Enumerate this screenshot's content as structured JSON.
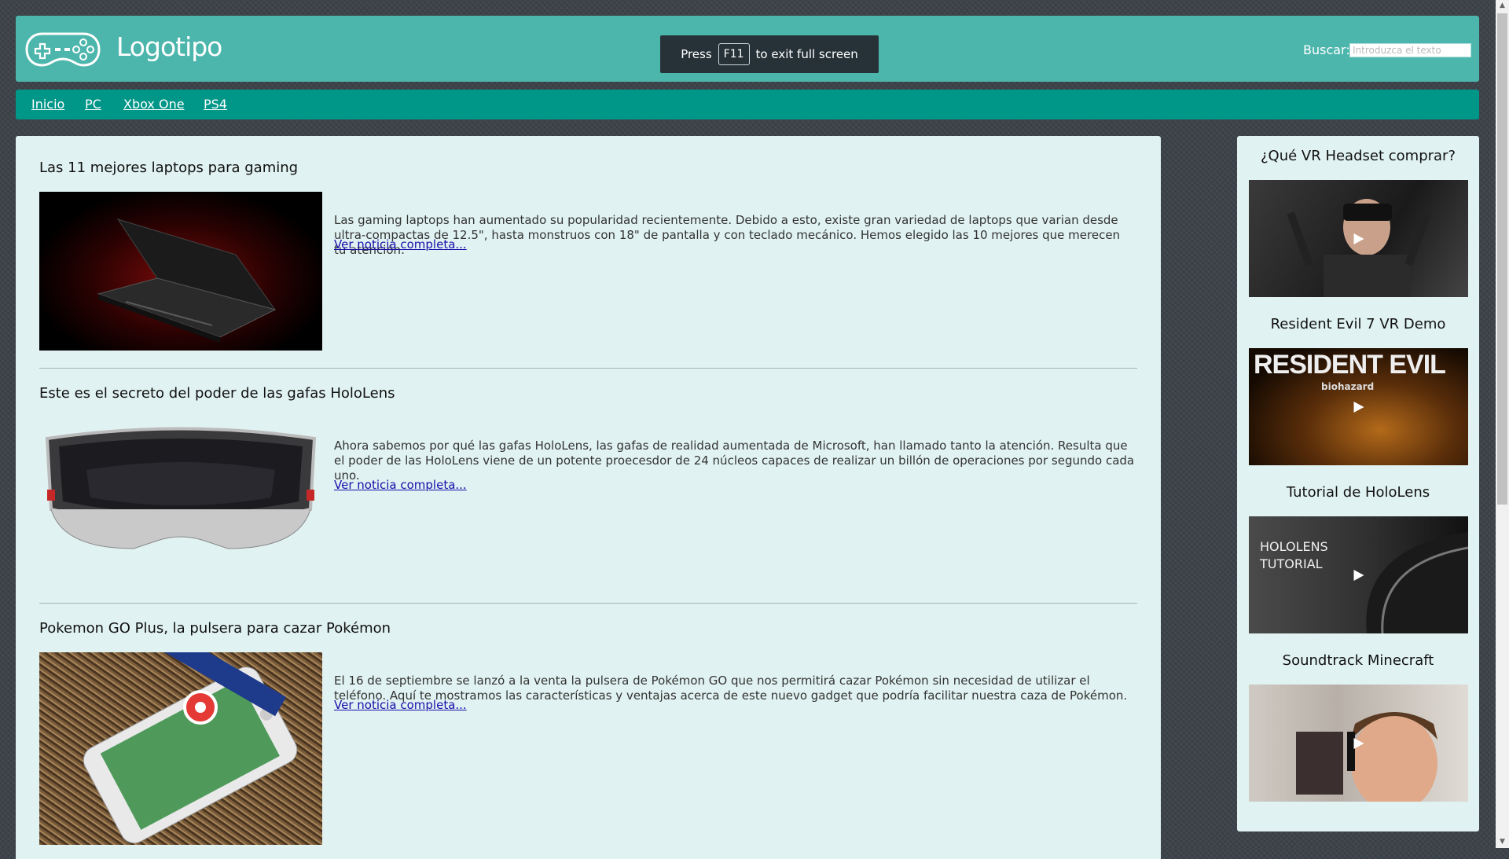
{
  "header": {
    "logo_text": "Logotipo",
    "fullscreen_notice": {
      "prefix": "Press",
      "key": "F11",
      "suffix": "to exit full screen"
    },
    "search": {
      "label": "Buscar:",
      "placeholder": "Introduzca el texto"
    }
  },
  "nav": {
    "items": [
      {
        "label": "Inicio"
      },
      {
        "label": "PC"
      },
      {
        "label": "Xbox One"
      },
      {
        "label": "PS4"
      }
    ]
  },
  "articles": [
    {
      "title": "Las 11 mejores laptops para gaming",
      "text": "Las gaming laptops han aumentado su popularidad recientemente. Debido a esto, existe gran variedad de laptops que varian desde ultra-compactas de 12.5\", hasta monstruos con 18\" de pantalla y con teclado mecánico. Hemos elegido las 10 mejores que merecen tu atención.",
      "link": "Ver noticia completa..."
    },
    {
      "title": "Este es el secreto del poder de las gafas HoloLens",
      "text": "Ahora sabemos por qué las gafas HoloLens, las gafas de realidad aumentada de Microsoft, han llamado tanto la atención. Resulta que el poder de las HoloLens viene de un potente proecesdor de 24 núcleos capaces de realizar un billón de operaciones por segundo cada uno.",
      "link": "Ver noticia completa..."
    },
    {
      "title": "Pokemon GO Plus, la pulsera para cazar Pokémon",
      "text": "El 16 de septiembre se lanzó a la venta la pulsera de Pokémon GO que nos permitirá cazar Pokémon sin necesidad de utilizar el teléfono. Aquí te mostramos las características y ventajas acerca de este nuevo gadget que podría facilitar nuestra caza de Pokémon.",
      "link": "Ver noticia completa..."
    }
  ],
  "sidebar": {
    "videos": [
      {
        "title": "¿Qué VR Headset comprar?"
      },
      {
        "title": "Resident Evil 7 VR Demo",
        "thumb_text": "RESIDENT EVIL",
        "thumb_subtext": "biohazard"
      },
      {
        "title": "Tutorial de HoloLens",
        "thumb_text": "HOLOLENS",
        "thumb_subtext": "TUTORIAL"
      },
      {
        "title": "Soundtrack Minecraft"
      }
    ]
  },
  "colors": {
    "header_bg": "#4db6ac",
    "nav_bg": "#009688",
    "panel_bg": "#e0f2f1",
    "link": "#1a0dab"
  }
}
